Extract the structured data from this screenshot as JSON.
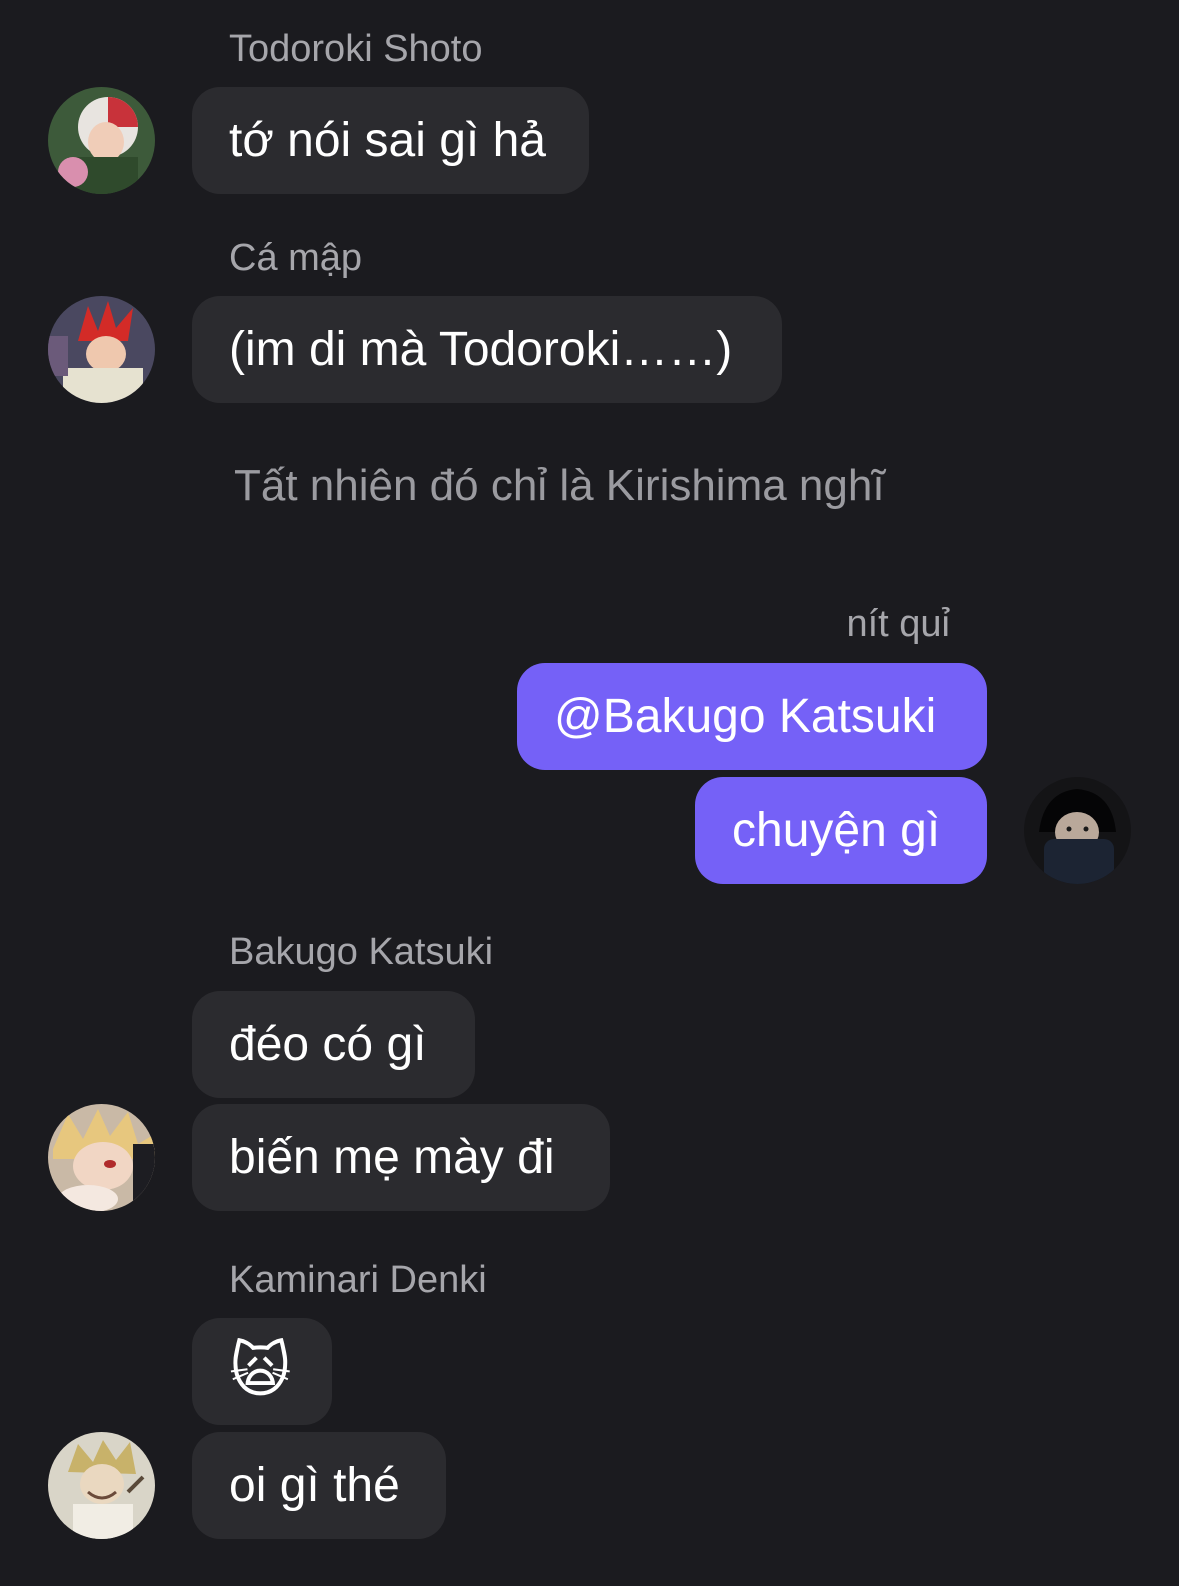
{
  "messages": {
    "todoroki": {
      "sender": "Todoroki Shoto",
      "text": "tớ nói sai gì hả"
    },
    "kirishima": {
      "sender": "Cá mập",
      "text": "(im di mà Todoroki……)"
    },
    "system_note": "Tất nhiên đó chỉ là Kirishima nghĩ",
    "me": {
      "sender": "nít quỉ",
      "lines": [
        "@Bakugo Katsuki",
        "chuyện gì"
      ]
    },
    "bakugo": {
      "sender": "Bakugo Katsuki",
      "lines": [
        "đéo có gì",
        "biến mẹ mày đi"
      ]
    },
    "kaminari": {
      "sender": "Kaminari Denki",
      "lines": [
        "🙀",
        "oi gì thé"
      ]
    }
  },
  "avatars": {
    "todoroki": "avatar-red-white-hair",
    "kirishima": "avatar-red-spiky-hair",
    "me": "avatar-dark-photo",
    "bakugo": "avatar-blond-hair",
    "kaminari": "avatar-blond-sketch"
  },
  "colors": {
    "background": "#1b1b1f",
    "incoming_bubble": "#2b2b2f",
    "outgoing_bubble": "#7561f7",
    "sender_text": "#a6a6ab"
  }
}
